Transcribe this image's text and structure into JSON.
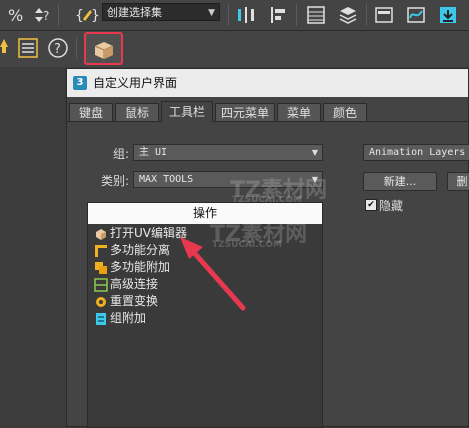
{
  "toolbar": {
    "selection_set": "创建选择集"
  },
  "dialog": {
    "app_icon": "3",
    "title": "自定义用户界面",
    "tabs": [
      "键盘",
      "鼠标",
      "工具栏",
      "四元菜单",
      "菜单",
      "颜色"
    ],
    "active_tab": "工具栏",
    "group_label": "组:",
    "group_value": "主 UI",
    "category_label": "类别:",
    "category_value": "MAX TOOLS",
    "action_header": "操作",
    "actions": [
      {
        "label": "打开UV编辑器",
        "icon": "uv-editor-icon"
      },
      {
        "label": "多功能分离",
        "icon": "multi-detach-icon"
      },
      {
        "label": "多功能附加",
        "icon": "multi-attach-icon"
      },
      {
        "label": "高级连接",
        "icon": "advanced-connect-icon"
      },
      {
        "label": "重置变换",
        "icon": "reset-xform-icon"
      },
      {
        "label": "组附加",
        "icon": "group-attach-icon"
      }
    ],
    "toolbar_dropdown": "Animation Layers",
    "new_button": "新建...",
    "delete_button": "删",
    "hide_checkbox": "隐藏",
    "hide_checked": true
  },
  "watermark": {
    "text1": "TZ素材网",
    "text2": "TZSUCAI.COM"
  },
  "colors": {
    "highlight_border": "#e8384f",
    "arrow": "#e8384f"
  }
}
